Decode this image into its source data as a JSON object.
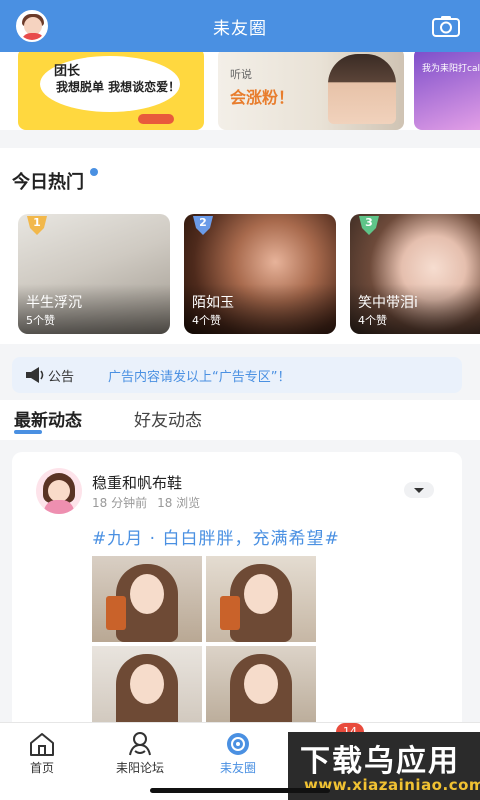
{
  "header": {
    "title": "耒友圈",
    "avatar_icon": "user-avatar",
    "camera_icon": "camera-icon"
  },
  "banners": {
    "b1_line1": "团长",
    "b1_line2": "我想脱单 我想谈恋爱！",
    "b2_line1": "听说",
    "b2_line2": "会涨粉！",
    "b3_line1": "我为耒阳打call"
  },
  "hot": {
    "title": "今日热门",
    "items": [
      {
        "rank": "1",
        "name": "半生浮沉",
        "likes": "5个赞",
        "rank_color": "#f2b84b"
      },
      {
        "rank": "2",
        "name": "陌如玉",
        "likes": "4个赞",
        "rank_color": "#6b9be8"
      },
      {
        "rank": "3",
        "name": "笑中带泪i",
        "likes": "4个赞",
        "rank_color": "#5fc489"
      }
    ]
  },
  "notice": {
    "label": "公告",
    "message": "广告内容请发以上“广告专区”！"
  },
  "tabs": {
    "active": "最新动态",
    "inactive": "好友动态"
  },
  "post": {
    "username": "稳重和帆布鞋",
    "time": "18 分钟前",
    "views": "18 浏览",
    "topic": "#九月 · 白白胖胖，充满希望#"
  },
  "bottom_nav": [
    {
      "label": "首页",
      "icon": "home-icon"
    },
    {
      "label": "耒阳论坛",
      "icon": "forum-icon"
    },
    {
      "label": "耒友圈",
      "icon": "circle-icon"
    },
    {
      "label": "",
      "icon": "message-icon",
      "badge": "14"
    },
    {
      "label": "",
      "icon": "profile-icon"
    }
  ],
  "watermark": {
    "line1": "下载乌应用",
    "line2": "www.xiazainiao.com"
  },
  "colors": {
    "primary": "#4a90e2",
    "badge": "#e84b3c"
  }
}
